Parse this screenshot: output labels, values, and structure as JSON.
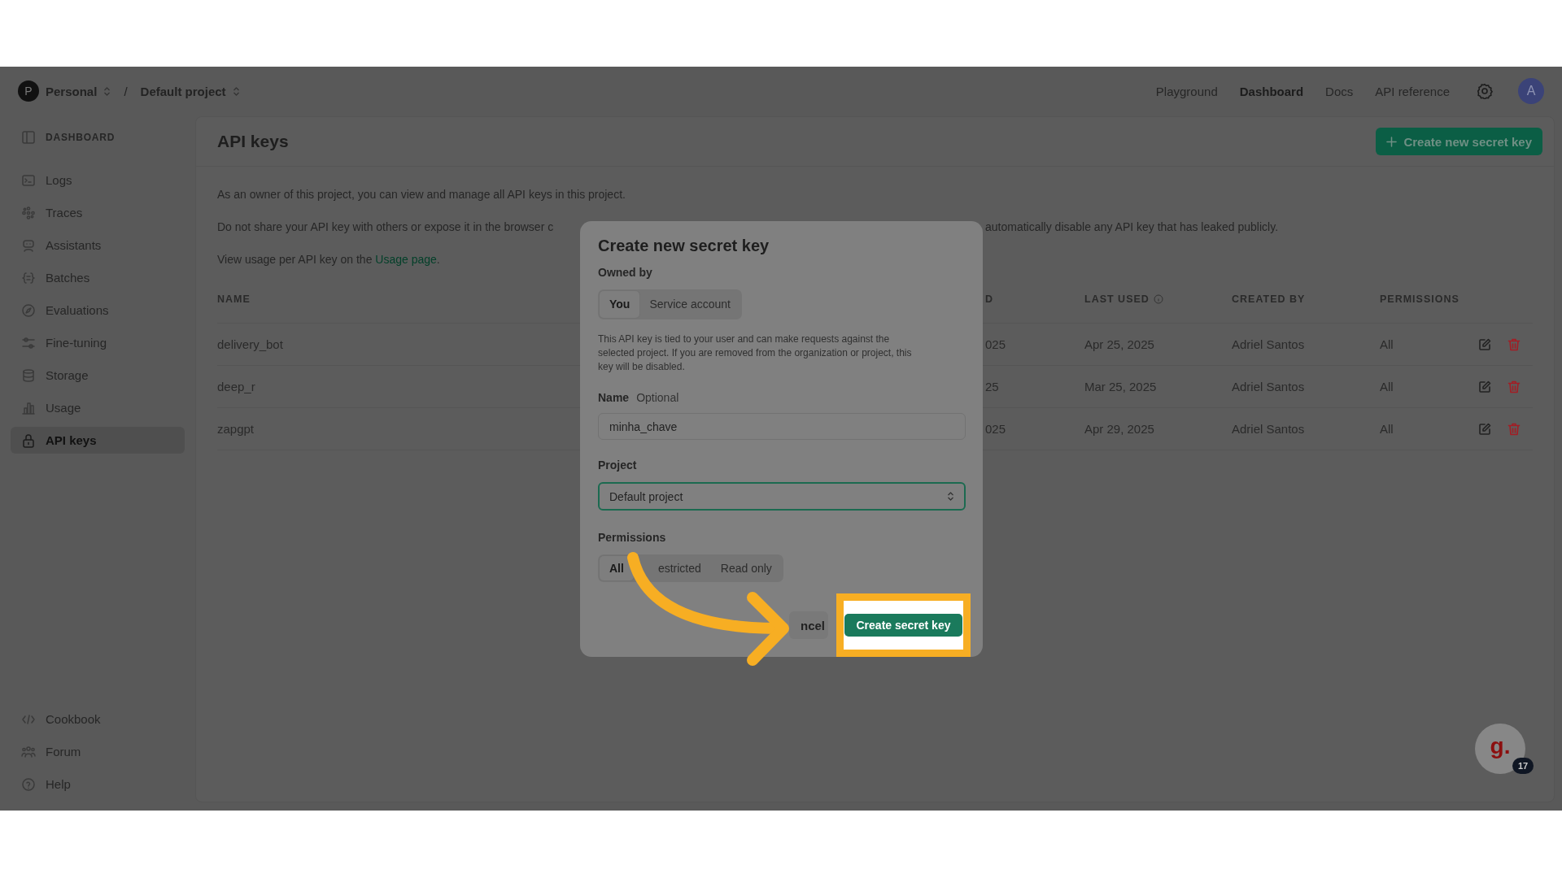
{
  "breadcrumb": {
    "org": {
      "initial": "P",
      "label": "Personal"
    },
    "separator": "/",
    "project": {
      "label": "Default project"
    }
  },
  "top_nav": [
    {
      "label": "Playground",
      "selected": false
    },
    {
      "label": "Dashboard",
      "selected": true
    },
    {
      "label": "Docs",
      "selected": false
    },
    {
      "label": "API reference",
      "selected": false
    }
  ],
  "user_avatar": "A",
  "sidebar": {
    "heading": "DASHBOARD",
    "items": [
      {
        "label": "Logs",
        "selected": false
      },
      {
        "label": "Traces",
        "selected": false
      },
      {
        "label": "Assistants",
        "selected": false
      },
      {
        "label": "Batches",
        "selected": false
      },
      {
        "label": "Evaluations",
        "selected": false
      },
      {
        "label": "Fine-tuning",
        "selected": false
      },
      {
        "label": "Storage",
        "selected": false
      },
      {
        "label": "Usage",
        "selected": false
      },
      {
        "label": "API keys",
        "selected": true
      }
    ],
    "footer_items": [
      {
        "label": "Cookbook",
        "selected": false
      },
      {
        "label": "Forum",
        "selected": false
      },
      {
        "label": "Help",
        "selected": false
      }
    ]
  },
  "page": {
    "title": "API keys",
    "create_button": "Create new secret key",
    "intro": "As an owner of this project, you can view and manage all API keys in this project.",
    "warning": {
      "before_dialog": "Do not share your API key with others or expose it in the browser c",
      "after_dialog": "automatically disable any API key that has leaked publicly."
    },
    "usage_note": {
      "text": "View usage per API key on the ",
      "link": "Usage page",
      "after": "."
    }
  },
  "table": {
    "columns": [
      {
        "label": "NAME"
      },
      {
        "label": "D"
      },
      {
        "label": "LAST USED"
      },
      {
        "label": "CREATED BY"
      },
      {
        "label": "PERMISSIONS"
      }
    ],
    "rows": [
      {
        "cells": [
          "delivery_bot",
          "025",
          "Apr 25, 2025",
          "Adriel Santos",
          "All"
        ]
      },
      {
        "cells": [
          "deep_r",
          "25",
          "Mar 25, 2025",
          "Adriel Santos",
          "All"
        ]
      },
      {
        "cells": [
          "zapgpt",
          "025",
          "Apr 29, 2025",
          "Adriel Santos",
          "All"
        ]
      }
    ]
  },
  "dialog": {
    "title": "Create new secret key",
    "owned_by": {
      "label": "Owned by",
      "options": [
        {
          "label": "You",
          "selected": true
        },
        {
          "label": "Service account",
          "selected": false
        }
      ]
    },
    "description": "This API key is tied to your user and can make requests against the selected project. If you are removed from the organization or project, this key will be disabled.",
    "name": {
      "label": "Name",
      "hint": "Optional",
      "value": "minha_chave"
    },
    "project": {
      "label": "Project",
      "value": "Default project"
    },
    "permissions": {
      "label": "Permissions",
      "options": [
        {
          "label": "All",
          "selected": true
        },
        {
          "label": "estricted",
          "selected": false
        },
        {
          "label": "Read only",
          "selected": false
        }
      ]
    },
    "cancel_button": "ncel",
    "submit_button": "Create secret key"
  },
  "help_widget": {
    "logo": "g.",
    "count": "17"
  }
}
